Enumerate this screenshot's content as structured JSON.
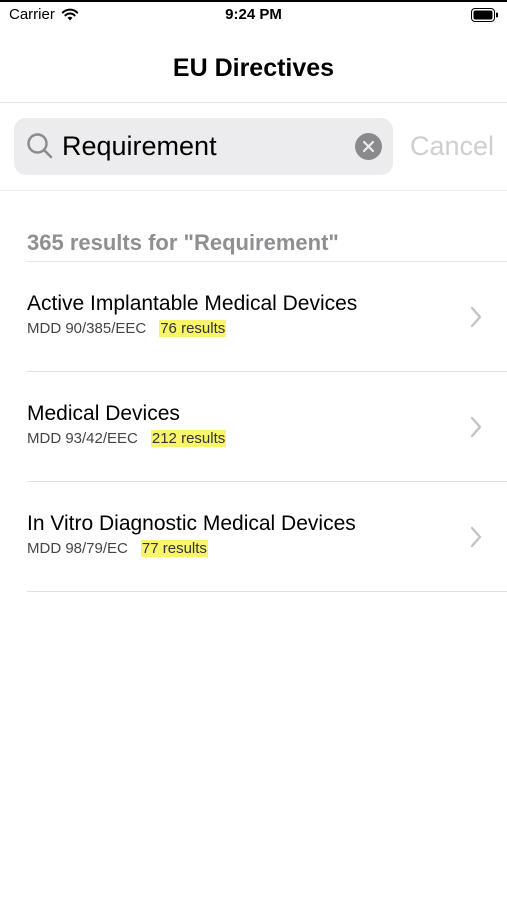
{
  "status_bar": {
    "carrier": "Carrier",
    "time": "9:24 PM"
  },
  "nav": {
    "title": "EU Directives"
  },
  "search": {
    "value": "Requirement",
    "cancel_label": "Cancel"
  },
  "results": {
    "summary": "365 results for \"Requirement\"",
    "items": [
      {
        "title": "Active Implantable Medical Devices",
        "code": "MDD 90/385/EEC",
        "count": "76 results"
      },
      {
        "title": "Medical Devices",
        "code": "MDD 93/42/EEC",
        "count": "212 results"
      },
      {
        "title": "In Vitro Diagnostic Medical Devices",
        "code": "MDD 98/79/EC",
        "count": "77 results"
      }
    ]
  },
  "colors": {
    "highlight": "#f8f56a",
    "secondary_text": "#8e8e93",
    "cancel_text": "#cfcfd3"
  }
}
